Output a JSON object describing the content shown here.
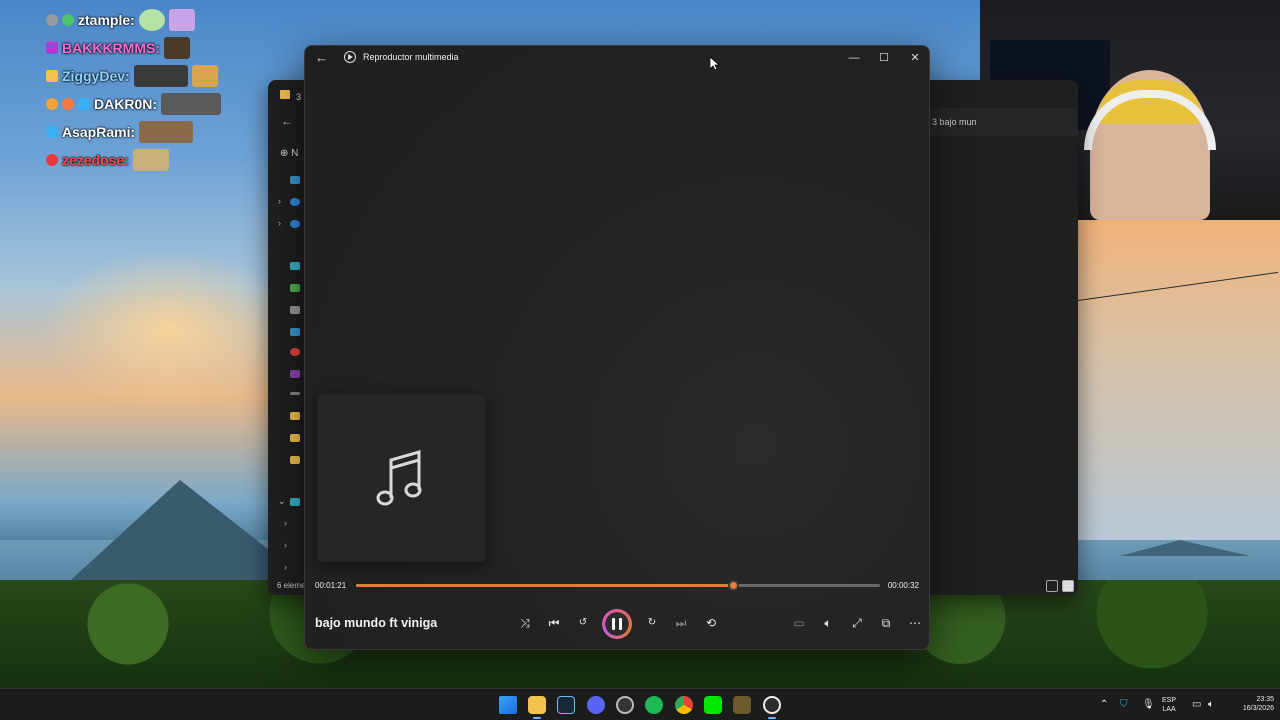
{
  "chat": [
    {
      "name": "ztample:",
      "color": "#ffffff"
    },
    {
      "name": "BAKKKRMMS:",
      "color": "#ff6ad5"
    },
    {
      "name": "ZiggyDev:",
      "color": "#8fd3ff"
    },
    {
      "name": "DAKR0N:",
      "color": "#ffffff"
    },
    {
      "name": "AsapRami:",
      "color": "#ffffff"
    },
    {
      "name": "zezedose:",
      "color": "#ff4a4a"
    }
  ],
  "explorer": {
    "tab_title": "3",
    "new_button": "N",
    "address": "3 bajo mun",
    "status": "6 eleme"
  },
  "player": {
    "app_title": "Reproductor multimedia",
    "time_elapsed": "00:01:21",
    "time_remaining": "00:00:32",
    "progress": 0.72,
    "track_title": "bajo mundo ft viniga",
    "accent": "#e87a3a"
  },
  "taskbar": {
    "lang_line1": "ESP",
    "lang_line2": "LAA",
    "time": "23:35",
    "date": "16/3/2026"
  }
}
